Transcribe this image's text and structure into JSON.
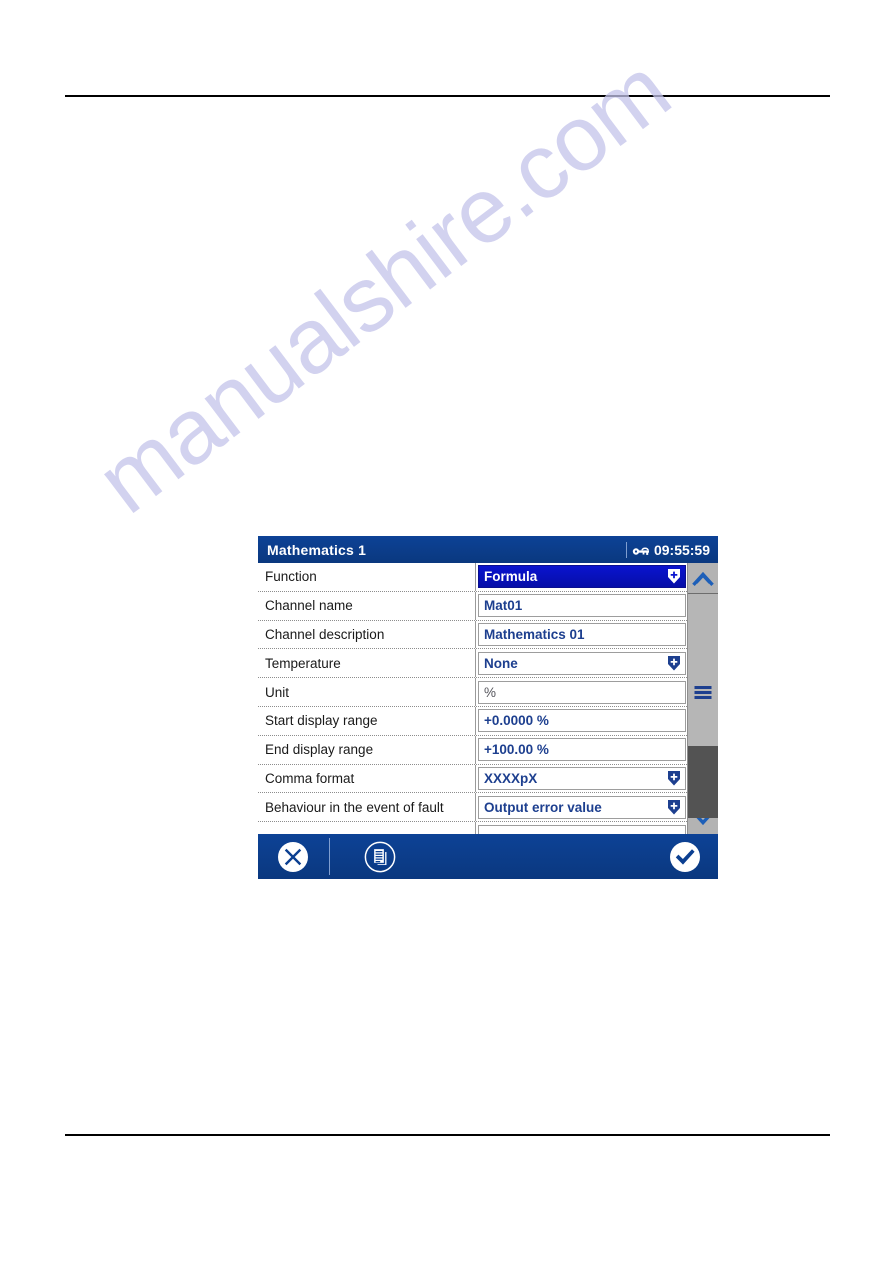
{
  "page": {
    "rules": [
      "top-rule",
      "bottom-rule"
    ],
    "watermark_text": "manualshire.com"
  },
  "dialog": {
    "title": "Mathematics 1",
    "clock": "09:55:59",
    "lock_icon": "key-lock-icon",
    "accent_color": "#0b3f91",
    "selected_color": "#0b14c8",
    "value_color": "#1d3f8f",
    "rows": [
      {
        "label": "Function",
        "value": "Formula",
        "type": "dropdown",
        "selected": true,
        "muted": false
      },
      {
        "label": "Channel name",
        "value": "Mat01",
        "type": "text",
        "selected": false,
        "muted": false
      },
      {
        "label": "Channel description",
        "value": "Mathematics 01",
        "type": "text",
        "selected": false,
        "muted": false
      },
      {
        "label": "Temperature",
        "value": "None",
        "type": "dropdown",
        "selected": false,
        "muted": false
      },
      {
        "label": "Unit",
        "value": "%",
        "type": "text",
        "selected": false,
        "muted": true
      },
      {
        "label": "Start display range",
        "value": "+0.0000 %",
        "type": "text",
        "selected": false,
        "muted": false
      },
      {
        "label": "End display range",
        "value": "+100.00 %",
        "type": "text",
        "selected": false,
        "muted": false
      },
      {
        "label": "Comma format",
        "value": "XXXXpX",
        "type": "dropdown",
        "selected": false,
        "muted": false
      },
      {
        "label": "Behaviour in the event of fault",
        "value": "Output error value",
        "type": "dropdown",
        "selected": false,
        "muted": false
      }
    ],
    "scrollbar": {
      "up_icon": "chevron-up-icon",
      "down_icon": "chevron-down-icon",
      "grip_icon": "drag-grip-icon"
    },
    "toolbar": {
      "cancel_icon": "cancel-x-circle-icon",
      "copy_icon": "copy-document-icon",
      "confirm_icon": "confirm-check-circle-icon"
    }
  }
}
